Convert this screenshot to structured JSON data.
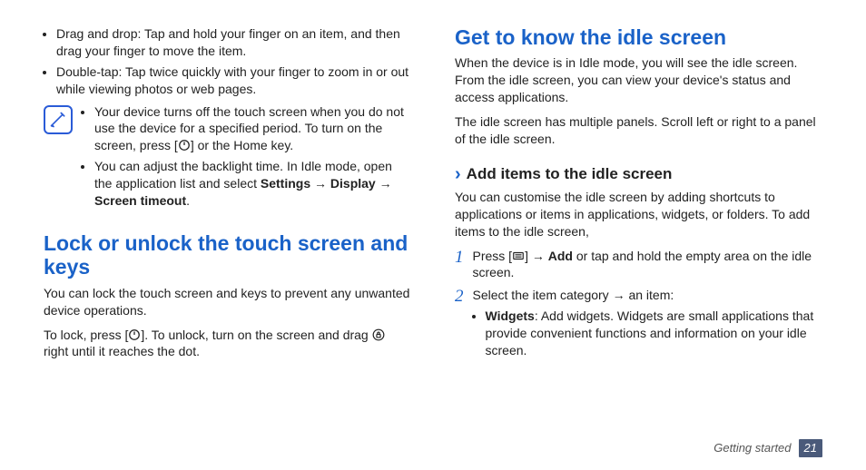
{
  "left": {
    "bullets": [
      "Drag and drop: Tap and hold your finger on an item, and then drag your finger to move the item.",
      "Double-tap: Tap twice quickly with your finger to zoom in or out while viewing photos or web pages."
    ],
    "note": [
      {
        "pre": "Your device turns off the touch screen when you do not use the device for a specified period. To turn on the screen, press [",
        "post": "] or the Home key."
      },
      {
        "pre": "You can adjust the backlight time. In Idle mode, open the application list and select ",
        "bold1": "Settings",
        "arrow1": " → ",
        "bold2": "Display",
        "arrow2": " → ",
        "bold3": "Screen timeout",
        "post": "."
      }
    ],
    "h2": "Lock or unlock the touch screen and keys",
    "p1": "You can lock the touch screen and keys to prevent any unwanted device operations.",
    "lock_pre": "To lock, press [",
    "lock_mid": "]. To unlock, turn on the screen and drag ",
    "lock_post": " right until it reaches the dot."
  },
  "right": {
    "h2": "Get to know the idle screen",
    "p1": "When the device is in Idle mode, you will see the idle screen. From the idle screen, you can view your device's status and access applications.",
    "p2": "The idle screen has multiple panels. Scroll left or right to a panel of the idle screen.",
    "chevron": "›",
    "sub": "Add items to the idle screen",
    "p3": "You can customise the idle screen by adding shortcuts to applications or items in applications, widgets, or folders. To add items to the idle screen,",
    "steps": [
      {
        "n": "1",
        "pre": "Press [",
        "arrow": "] → ",
        "bold": "Add",
        "post": " or tap and hold the empty area on the idle screen."
      },
      {
        "n": "2",
        "text": "Select the item category → an item:",
        "bullets": [
          {
            "bold": "Widgets",
            "text": ": Add widgets. Widgets are small applications that provide convenient functions and information on your idle screen."
          }
        ]
      }
    ]
  },
  "footer": {
    "section": "Getting started",
    "page": "21"
  }
}
